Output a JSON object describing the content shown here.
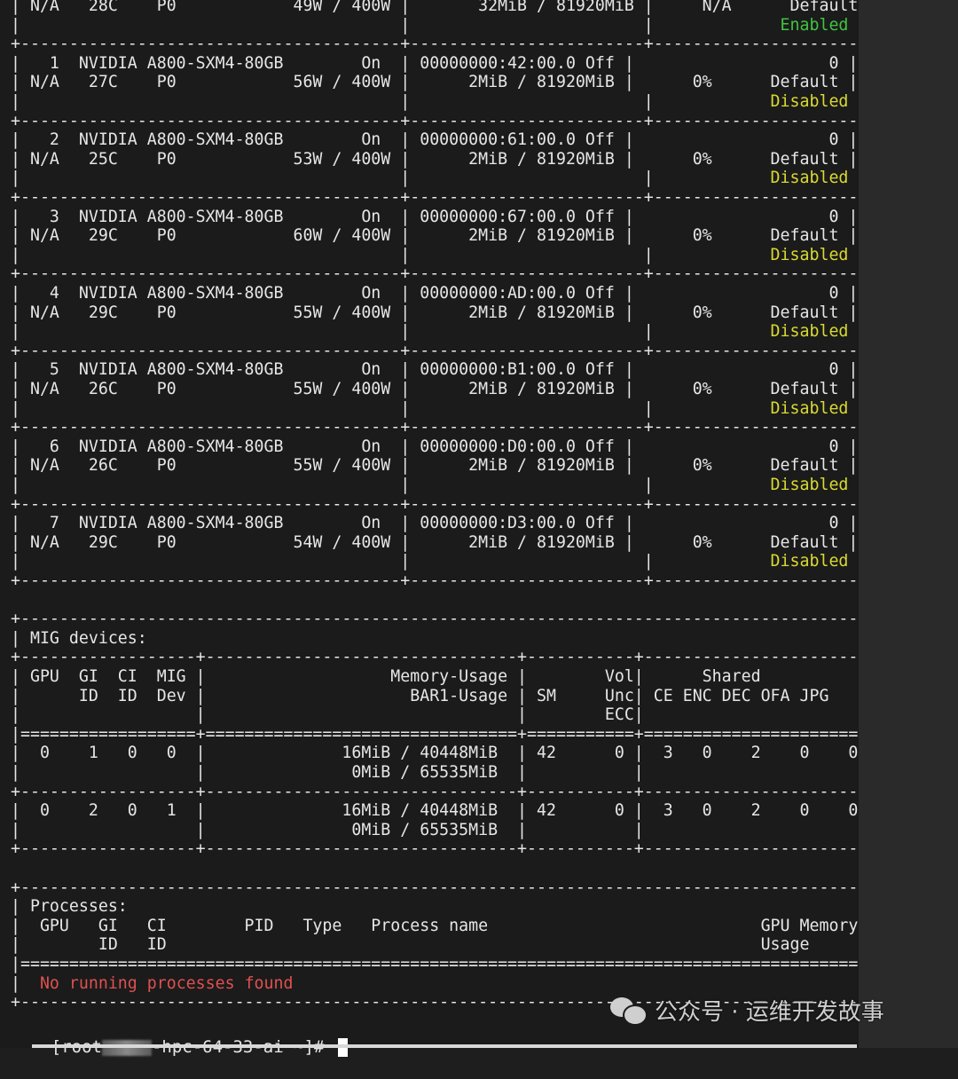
{
  "terminal": {
    "lines": [
      [
        {
          "t": "| N/A   28C    P0            49W / 400W |       32MiB / 81920MiB |     N/A      Default |"
        }
      ],
      [
        {
          "t": "|                                       |                        |             "
        },
        {
          "t": "Enabled",
          "c": "green"
        },
        {
          "t": " |"
        }
      ],
      [
        {
          "t": "+---------------------------------------+------------------------+----------------------+"
        }
      ],
      [
        {
          "t": "|   1  NVIDIA A800-SXM4-80GB        On  | 00000000:42:00.0 Off |                    0 |"
        }
      ],
      [
        {
          "t": "| N/A   27C    P0            56W / 400W |      2MiB / 81920MiB |      0%      Default |"
        }
      ],
      [
        {
          "t": "|                                       |                        |            "
        },
        {
          "t": "Disabled",
          "c": "yellow"
        },
        {
          "t": " |"
        }
      ],
      [
        {
          "t": "+---------------------------------------+------------------------+----------------------+"
        }
      ],
      [
        {
          "t": "|   2  NVIDIA A800-SXM4-80GB        On  | 00000000:61:00.0 Off |                    0 |"
        }
      ],
      [
        {
          "t": "| N/A   25C    P0            53W / 400W |      2MiB / 81920MiB |      0%      Default |"
        }
      ],
      [
        {
          "t": "|                                       |                        |            "
        },
        {
          "t": "Disabled",
          "c": "yellow"
        },
        {
          "t": " |"
        }
      ],
      [
        {
          "t": "+---------------------------------------+------------------------+----------------------+"
        }
      ],
      [
        {
          "t": "|   3  NVIDIA A800-SXM4-80GB        On  | 00000000:67:00.0 Off |                    0 |"
        }
      ],
      [
        {
          "t": "| N/A   29C    P0            60W / 400W |      2MiB / 81920MiB |      0%      Default |"
        }
      ],
      [
        {
          "t": "|                                       |                        |            "
        },
        {
          "t": "Disabled",
          "c": "yellow"
        },
        {
          "t": " |"
        }
      ],
      [
        {
          "t": "+---------------------------------------+------------------------+----------------------+"
        }
      ],
      [
        {
          "t": "|   4  NVIDIA A800-SXM4-80GB        On  | 00000000:AD:00.0 Off |                    0 |"
        }
      ],
      [
        {
          "t": "| N/A   29C    P0            55W / 400W |      2MiB / 81920MiB |      0%      Default |"
        }
      ],
      [
        {
          "t": "|                                       |                        |            "
        },
        {
          "t": "Disabled",
          "c": "yellow"
        },
        {
          "t": " |"
        }
      ],
      [
        {
          "t": "+---------------------------------------+------------------------+----------------------+"
        }
      ],
      [
        {
          "t": "|   5  NVIDIA A800-SXM4-80GB        On  | 00000000:B1:00.0 Off |                    0 |"
        }
      ],
      [
        {
          "t": "| N/A   26C    P0            55W / 400W |      2MiB / 81920MiB |      0%      Default |"
        }
      ],
      [
        {
          "t": "|                                       |                        |            "
        },
        {
          "t": "Disabled",
          "c": "yellow"
        },
        {
          "t": " |"
        }
      ],
      [
        {
          "t": "+---------------------------------------+------------------------+----------------------+"
        }
      ],
      [
        {
          "t": "|   6  NVIDIA A800-SXM4-80GB        On  | 00000000:D0:00.0 Off |                    0 |"
        }
      ],
      [
        {
          "t": "| N/A   26C    P0            55W / 400W |      2MiB / 81920MiB |      0%      Default |"
        }
      ],
      [
        {
          "t": "|                                       |                        |            "
        },
        {
          "t": "Disabled",
          "c": "yellow"
        },
        {
          "t": " |"
        }
      ],
      [
        {
          "t": "+---------------------------------------+------------------------+----------------------+"
        }
      ],
      [
        {
          "t": "|   7  NVIDIA A800-SXM4-80GB        On  | 00000000:D3:00.0 Off |                    0 |"
        }
      ],
      [
        {
          "t": "| N/A   29C    P0            54W / 400W |      2MiB / 81920MiB |      0%      Default |"
        }
      ],
      [
        {
          "t": "|                                       |                        |            "
        },
        {
          "t": "Disabled",
          "c": "yellow"
        },
        {
          "t": " |"
        }
      ],
      [
        {
          "t": "+---------------------------------------+------------------------+----------------------+"
        }
      ],
      [
        {
          "t": ""
        }
      ],
      [
        {
          "t": "+---------------------------------------------------------------------------------------+"
        }
      ],
      [
        {
          "t": "| MIG devices:                                                                          |"
        }
      ],
      [
        {
          "t": "+------------------+--------------------------------+-----------+-----------------------+"
        }
      ],
      [
        {
          "t": "| GPU  GI  CI  MIG |                   Memory-Usage |        Vol|      Shared           |"
        }
      ],
      [
        {
          "t": "|      ID  ID  Dev |                     BAR1-Usage | SM     Unc| CE ENC DEC OFA JPG    |"
        }
      ],
      [
        {
          "t": "|                  |                                |        ECC|                       |"
        }
      ],
      [
        {
          "t": "|==================+================================+===========+=======================|"
        }
      ],
      [
        {
          "t": "|  0    1   0   0  |              16MiB / 40448MiB  | 42      0 |  3   0    2    0    0 |"
        }
      ],
      [
        {
          "t": "|                  |               0MiB / 65535MiB  |           |                       |"
        }
      ],
      [
        {
          "t": "+------------------+--------------------------------+-----------+-----------------------+"
        }
      ],
      [
        {
          "t": "|  0    2   0   1  |              16MiB / 40448MiB  | 42      0 |  3   0    2    0    0 |"
        }
      ],
      [
        {
          "t": "|                  |               0MiB / 65535MiB  |           |                       |"
        }
      ],
      [
        {
          "t": "+------------------+--------------------------------+-----------+-----------------------+"
        }
      ],
      [
        {
          "t": ""
        }
      ],
      [
        {
          "t": "+---------------------------------------------------------------------------------------+"
        }
      ],
      [
        {
          "t": "| Processes:                                                                            |"
        }
      ],
      [
        {
          "t": "|  GPU   GI   CI        PID   Type   Process name                            GPU Memory |"
        }
      ],
      [
        {
          "t": "|        ID   ID                                                             Usage      |"
        }
      ],
      [
        {
          "t": "|=======================================================================================|"
        }
      ],
      [
        {
          "t": "|  "
        },
        {
          "t": "No running processes found",
          "c": "red"
        },
        {
          "t": "                                                           |"
        }
      ],
      [
        {
          "t": "+---------------------------------------------------------------------------------------+"
        }
      ]
    ],
    "prompt_prefix": "[root",
    "prompt_suffix": "-hpc-64-33-ai ~]# "
  },
  "watermark": {
    "text": "公众号 · 运维开发故事",
    "icon": "wechat-icon"
  },
  "colors": {
    "background": "#1b1b1b",
    "text": "#e6e6e6",
    "enabled": "#3fc43f",
    "disabled": "#d9d933",
    "no_processes": "#e05050"
  }
}
